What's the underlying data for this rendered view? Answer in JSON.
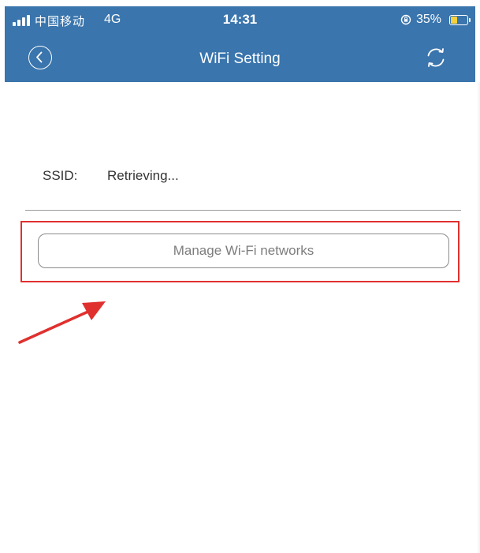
{
  "status_bar": {
    "carrier": "中国移动",
    "network": "4G",
    "time": "14:31",
    "battery_percent": "35%",
    "battery_level": 0.35,
    "signal_icon": "signal-bars-icon",
    "lock_icon": "orientation-lock-icon",
    "battery_icon": "battery-icon"
  },
  "nav_bar": {
    "title": "WiFi Setting",
    "back_icon": "chevron-left-circle-icon",
    "refresh_icon": "refresh-icon"
  },
  "ssid": {
    "label": "SSID:",
    "value": "Retrieving..."
  },
  "manage_button": {
    "label": "Manage Wi-Fi networks"
  },
  "colors": {
    "header": "#3a75ad",
    "highlight": "#e0302e",
    "button_text": "#7d7d7d"
  }
}
